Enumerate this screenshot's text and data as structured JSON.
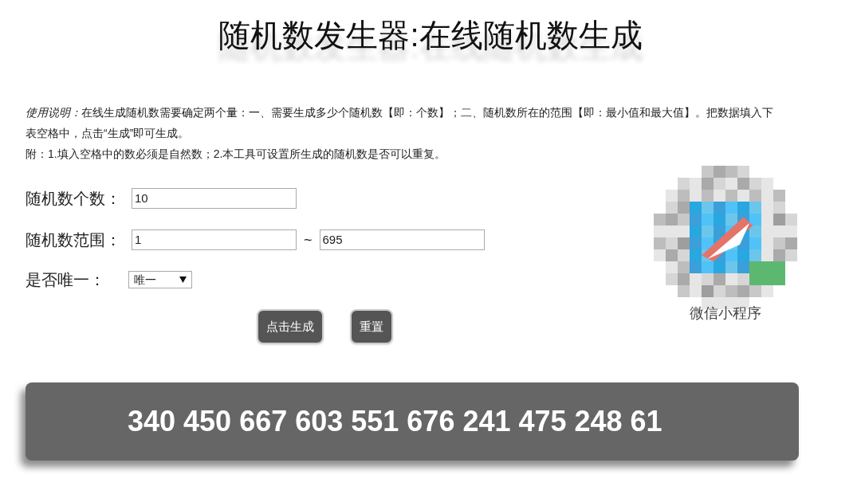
{
  "title": "随机数发生器:在线随机数生成",
  "instructions_lead": "使用说明：",
  "instructions": [
    "在线生成随机数需要确定两个量：一、需要生成多少个随机数【即：个数】；二、随机数所在的范围【即：最小值和最大值】。把数据填入下表空格中，点击“生成”即可生成。",
    "附：1.填入空格中的数必须是自然数；2.本工具可设置所生成的随机数是否可以重复。"
  ],
  "count": {
    "label": "随机数个数：",
    "value": "10"
  },
  "range": {
    "label": "随机数范围：",
    "min": "1",
    "separator": "~",
    "max": "695"
  },
  "unique": {
    "label": "是否唯一：",
    "value": "唯一"
  },
  "buttons": [
    "点击生成",
    "重置"
  ],
  "qr": {
    "caption": "微信小程序"
  },
  "result": "340 450 667 603 551 676 241 475 248 61"
}
